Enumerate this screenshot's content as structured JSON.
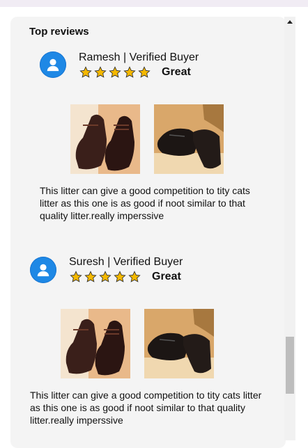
{
  "section": {
    "title": "Top reviews"
  },
  "reviews": [
    {
      "name": "Ramesh | Verified Buyer",
      "rating": 5,
      "rating_label": "Great",
      "text": "This litter can give a good competition to tity cats litter as this one is as good if noot similar to that quality litter.really imperssive",
      "images": [
        "oxford-shoes-photo",
        "derby-shoes-photo"
      ]
    },
    {
      "name": "Suresh | Verified Buyer",
      "rating": 5,
      "rating_label": "Great",
      "text": "This litter can give a good competition to tity cats litter as this one is as good if noot similar to that quality litter.really imperssive",
      "images": [
        "oxford-shoes-photo",
        "derby-shoes-photo"
      ]
    }
  ],
  "colors": {
    "avatar": "#1e88e5",
    "star": "#f5b800",
    "panel": "#f4f4f4"
  },
  "icons": {
    "avatar": "user-icon",
    "star": "star-icon",
    "scroll_up": "caret-up-icon"
  }
}
